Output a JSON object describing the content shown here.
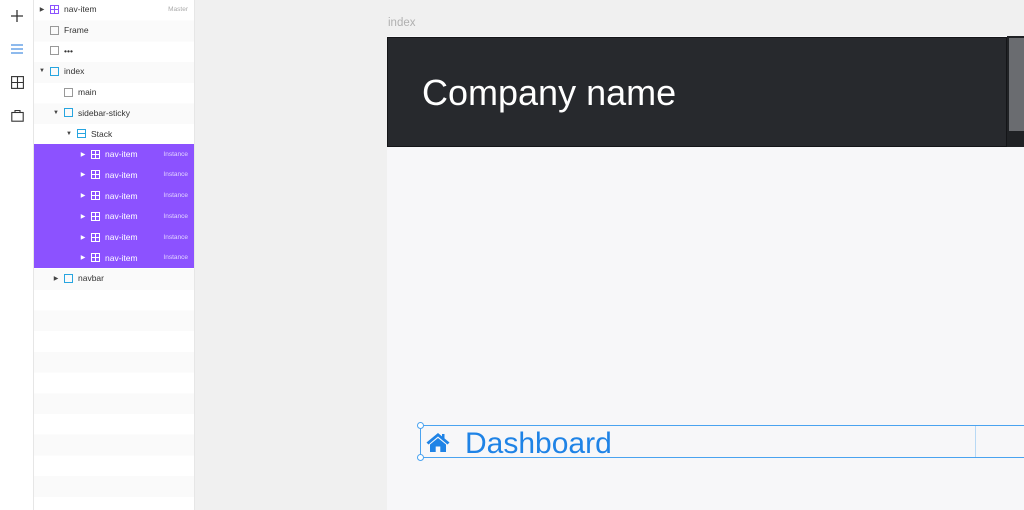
{
  "toolbar": {
    "items": [
      {
        "icon": "plus-icon"
      },
      {
        "icon": "layers-icon",
        "active": true
      },
      {
        "icon": "grid-icon"
      },
      {
        "icon": "bag-icon"
      }
    ]
  },
  "layers": {
    "rows": [
      {
        "label": "nav-item",
        "tag": "Master"
      },
      {
        "label": "Frame"
      },
      {
        "label": "•••"
      },
      {
        "label": "index"
      },
      {
        "label": "main"
      },
      {
        "label": "sidebar-sticky"
      },
      {
        "label": "Stack"
      },
      {
        "label": "nav-item",
        "tag": "Instance"
      },
      {
        "label": "nav-item",
        "tag": "Instance"
      },
      {
        "label": "nav-item",
        "tag": "Instance"
      },
      {
        "label": "nav-item",
        "tag": "Instance"
      },
      {
        "label": "nav-item",
        "tag": "Instance"
      },
      {
        "label": "nav-item",
        "tag": "Instance"
      },
      {
        "label": "navbar"
      }
    ]
  },
  "canvas": {
    "frame_title": "index",
    "company_name": "Company name",
    "nav_item_label": "Dashboard",
    "nav_item_icon": "home-icon"
  },
  "colors": {
    "selection": "#8c52ff",
    "accent": "#1f83e6",
    "navbar_bg": "#27292d"
  }
}
